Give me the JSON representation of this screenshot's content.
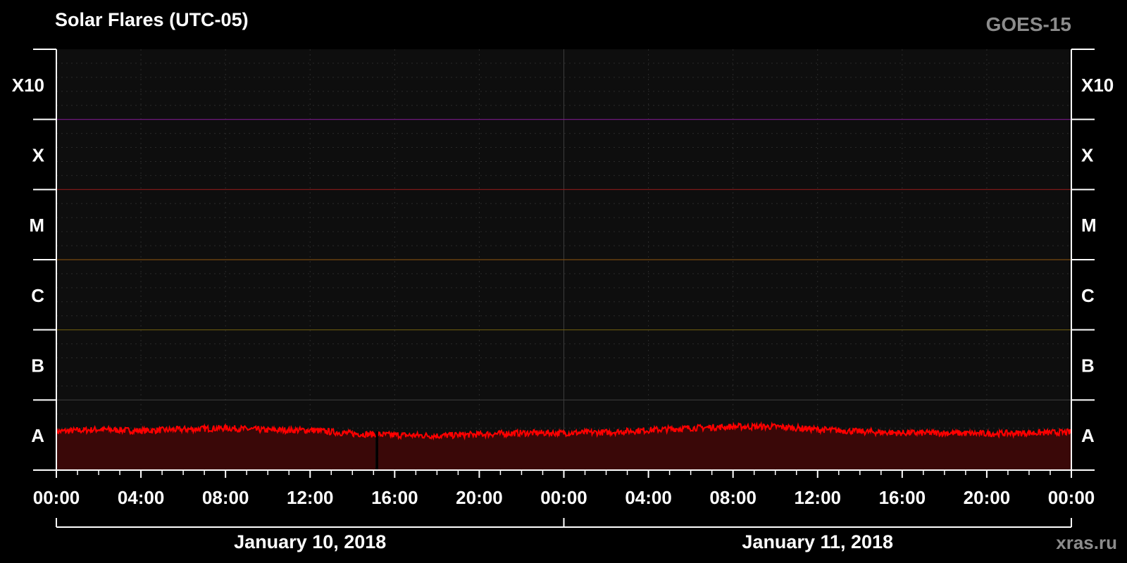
{
  "title": "Solar Flares (UTC-05)",
  "satellite": "GOES-15",
  "credit": "xras.ru",
  "colors": {
    "background": "#000000",
    "plot_bg": "#0e0e0e",
    "flux_line": "#ff0000",
    "flux_fill": "#3a0808",
    "x10_line": "#7a1a8a",
    "x_line": "#8a1a1a",
    "m_line": "#7a4a10",
    "c_line": "#6a5a10",
    "b_line": "#3a3a3a",
    "grid": "#2a2a2a"
  },
  "chart_data": {
    "type": "line",
    "title": "Solar Flares (UTC-05)",
    "y_scale": "log",
    "flare_classes": [
      {
        "label": "A",
        "class": "A"
      },
      {
        "label": "B",
        "class": "B"
      },
      {
        "label": "C",
        "class": "C"
      },
      {
        "label": "M",
        "class": "M"
      },
      {
        "label": "X",
        "class": "X"
      },
      {
        "label": "X10",
        "class": "X10"
      }
    ],
    "x_tick_labels": [
      "00:00",
      "04:00",
      "08:00",
      "12:00",
      "16:00",
      "20:00",
      "00:00",
      "04:00",
      "08:00",
      "12:00",
      "16:00",
      "20:00",
      "00:00"
    ],
    "x_range_hours": [
      0,
      48
    ],
    "date_labels": [
      {
        "label": "January 10, 2018",
        "start_hour": 0,
        "end_hour": 24
      },
      {
        "label": "January 11, 2018",
        "start_hour": 24,
        "end_hour": 48
      }
    ],
    "series": [
      {
        "hours": [
          0,
          2,
          4,
          6,
          8,
          10,
          12,
          14,
          16,
          18,
          20,
          22,
          24,
          26,
          28,
          30,
          32,
          34,
          36,
          38,
          40,
          42,
          44,
          46,
          48
        ],
        "class_value": [
          0.55,
          0.58,
          0.56,
          0.58,
          0.6,
          0.57,
          0.57,
          0.52,
          0.5,
          0.49,
          0.51,
          0.53,
          0.53,
          0.54,
          0.57,
          0.6,
          0.62,
          0.62,
          0.58,
          0.55,
          0.53,
          0.53,
          0.52,
          0.53,
          0.54
        ],
        "gap_hour": 15.1
      }
    ]
  }
}
